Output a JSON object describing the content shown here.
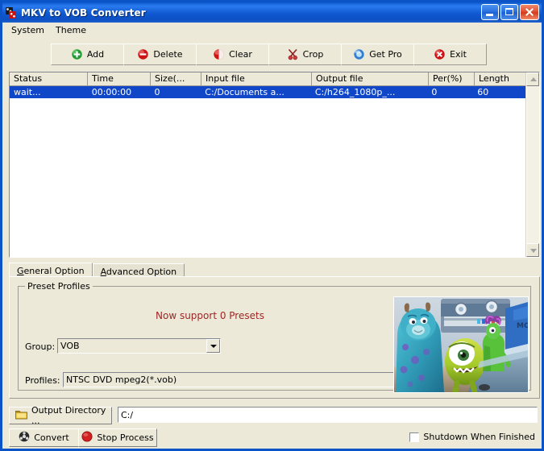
{
  "window": {
    "title": "MKV to VOB Converter",
    "icon": "app-icon",
    "minimize_label": "Minimize",
    "maximize_label": "Maximize",
    "close_label": "Close"
  },
  "menubar": {
    "items": [
      {
        "label": "System",
        "name": "menu-system"
      },
      {
        "label": "Theme",
        "name": "menu-theme"
      }
    ]
  },
  "toolbar": {
    "buttons": [
      {
        "label": "Add",
        "icon": "add-icon"
      },
      {
        "label": "Delete",
        "icon": "delete-icon"
      },
      {
        "label": "Clear",
        "icon": "clear-icon"
      },
      {
        "label": "Crop",
        "icon": "crop-icon"
      },
      {
        "label": "Get Pro",
        "icon": "get-pro-icon"
      },
      {
        "label": "Exit",
        "icon": "exit-icon"
      }
    ]
  },
  "filelist": {
    "columns": [
      {
        "label": "Status",
        "width": 97
      },
      {
        "label": "Time",
        "width": 78
      },
      {
        "label": "Size(...",
        "width": 63
      },
      {
        "label": "Input file",
        "width": 137
      },
      {
        "label": "Output file",
        "width": 145
      },
      {
        "label": "Per(%)",
        "width": 57
      },
      {
        "label": "Length",
        "width": 65
      }
    ],
    "rows": [
      {
        "status": "wait...",
        "time": "00:00:00",
        "size": "0",
        "input_file": "C:/Documents a...",
        "output_file": "C:/h264_1080p_...",
        "percent": "0",
        "length": "60",
        "selected": true
      }
    ]
  },
  "tabs": [
    {
      "label": "General Option",
      "accel": "G",
      "active": true
    },
    {
      "label": "Advanced Option",
      "accel": "A",
      "active": false
    }
  ],
  "general_option": {
    "groupbox_title": "Preset Profiles",
    "preset_message": "Now support 0 Presets",
    "preset_message_color": "#9e2626",
    "group_label": "Group:",
    "group_value": "VOB",
    "profiles_label": "Profiles:",
    "profiles_value": "NTSC DVD mpeg2(*.vob)",
    "preview_name": "preview-thumbnail"
  },
  "output": {
    "button_label": "Output Directory ...",
    "button_icon": "folder-icon",
    "path_value": "C:/",
    "path_placeholder": ""
  },
  "bottom": {
    "convert_label": "Convert",
    "convert_icon": "convert-icon",
    "stop_label": "Stop Process",
    "stop_icon": "stop-icon",
    "shutdown_label": "Shutdown When Finished",
    "shutdown_checked": false
  },
  "colors": {
    "title_blue": "#0c57c9",
    "face": "#ece9d8",
    "selection": "#1046c8",
    "accent_red": "#9e2626"
  }
}
